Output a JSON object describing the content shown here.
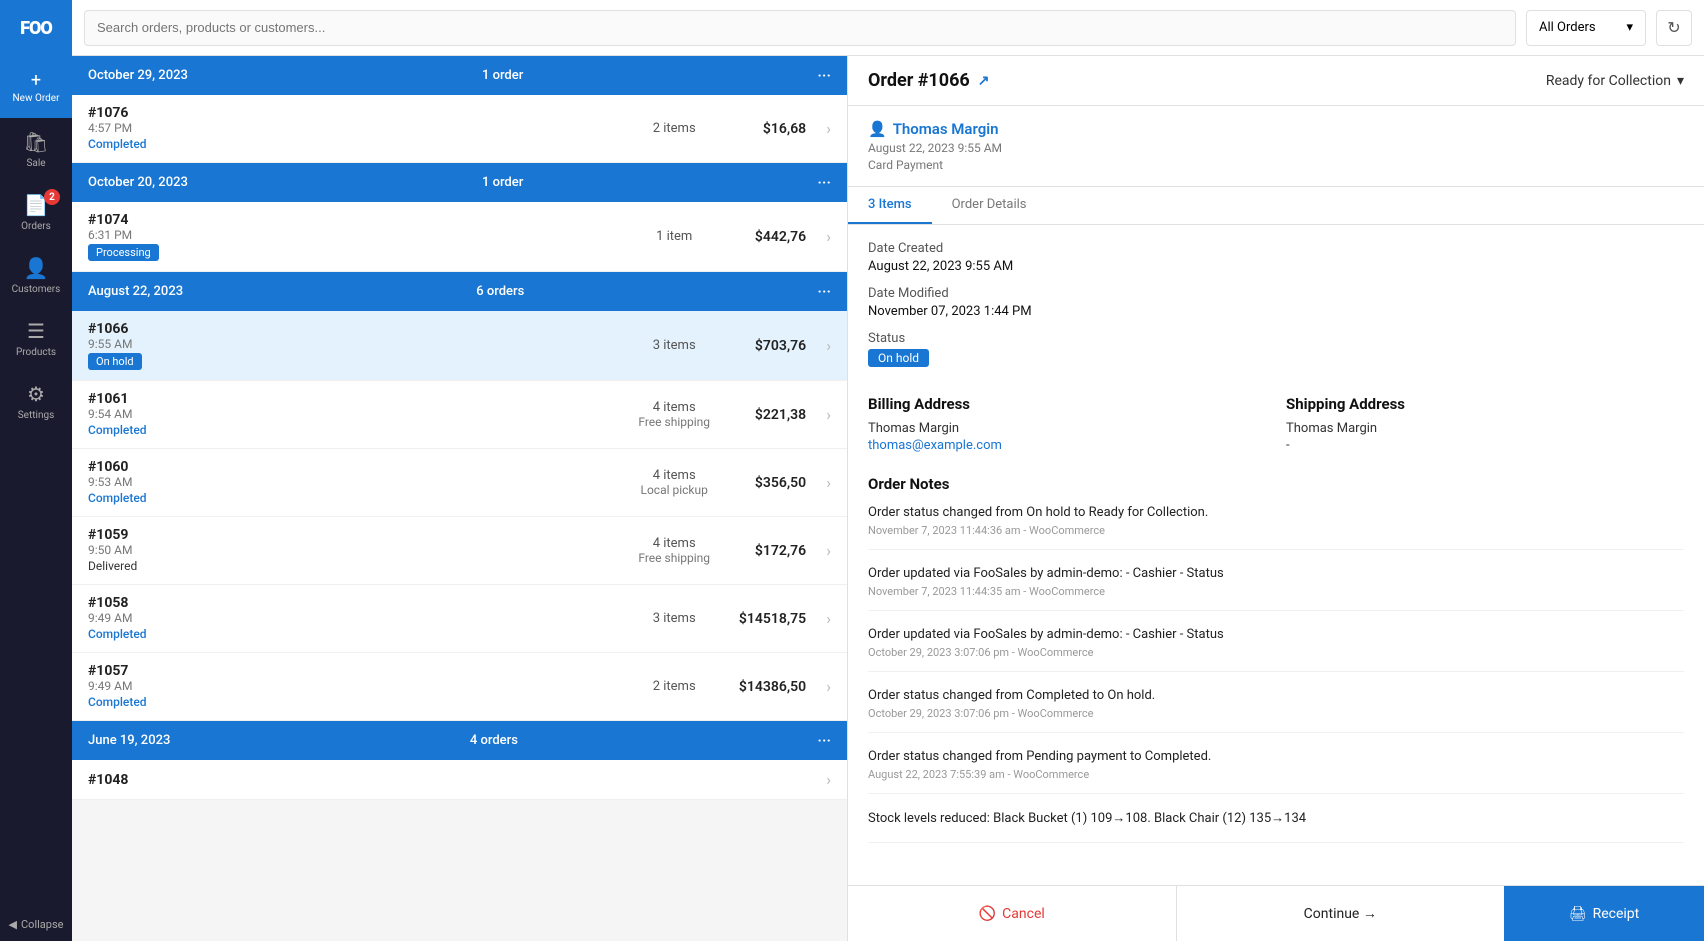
{
  "sidebar": {
    "logo": "FOO",
    "new_order_label": "New Order",
    "items": [
      {
        "id": "sale",
        "icon": "🛍",
        "label": "Sale"
      },
      {
        "id": "orders",
        "icon": "📄",
        "label": "Orders",
        "badge": "2"
      },
      {
        "id": "customers",
        "icon": "👤",
        "label": "Customers"
      },
      {
        "id": "products",
        "icon": "☰",
        "label": "Products"
      },
      {
        "id": "settings",
        "icon": "⚙",
        "label": "Settings"
      }
    ],
    "collapse_label": "Collapse"
  },
  "topbar": {
    "search_placeholder": "Search orders, products or customers...",
    "filter_label": "All Orders",
    "refresh_icon": "↻"
  },
  "orders": {
    "groups": [
      {
        "date": "October 29, 2023",
        "count": "1 order",
        "orders": [
          {
            "id": "#1076",
            "time": "4:57 PM",
            "status": "Completed",
            "status_type": "completed",
            "items": "2 items",
            "shipping": "",
            "amount": "$16,68",
            "selected": false
          }
        ]
      },
      {
        "date": "October 20, 2023",
        "count": "1 order",
        "orders": [
          {
            "id": "#1074",
            "time": "6:31 PM",
            "status": "Processing",
            "status_type": "processing",
            "items": "1 item",
            "shipping": "",
            "amount": "$442,76",
            "selected": false
          }
        ]
      },
      {
        "date": "August 22, 2023",
        "count": "6 orders",
        "orders": [
          {
            "id": "#1066",
            "time": "9:55 AM",
            "status": "On hold",
            "status_type": "onhold",
            "items": "3 items",
            "shipping": "",
            "amount": "$703,76",
            "selected": true
          },
          {
            "id": "#1061",
            "time": "9:54 AM",
            "status": "Completed",
            "status_type": "completed",
            "items": "4 items",
            "shipping": "Free shipping",
            "amount": "$221,38",
            "selected": false
          },
          {
            "id": "#1060",
            "time": "9:53 AM",
            "status": "Completed",
            "status_type": "completed",
            "items": "4 items",
            "shipping": "Local pickup",
            "amount": "$356,50",
            "selected": false
          },
          {
            "id": "#1059",
            "time": "9:50 AM",
            "status": "Delivered",
            "status_type": "delivered",
            "items": "4 items",
            "shipping": "Free shipping",
            "amount": "$172,76",
            "selected": false
          },
          {
            "id": "#1058",
            "time": "9:49 AM",
            "status": "Completed",
            "status_type": "completed",
            "items": "3 items",
            "shipping": "",
            "amount": "$14518,75",
            "selected": false
          },
          {
            "id": "#1057",
            "time": "9:49 AM",
            "status": "Completed",
            "status_type": "completed",
            "items": "2 items",
            "shipping": "",
            "amount": "$14386,50",
            "selected": false
          }
        ]
      },
      {
        "date": "June 19, 2023",
        "count": "4 orders",
        "orders": [
          {
            "id": "#1048",
            "time": "",
            "status": "",
            "status_type": "",
            "items": "",
            "shipping": "",
            "amount": "",
            "selected": false
          }
        ]
      }
    ]
  },
  "detail": {
    "order_number": "Order #1066",
    "external_link_icon": "↗",
    "status_dropdown": "Ready for Collection",
    "customer": {
      "name": "Thomas Margin",
      "date": "August 22, 2023 9:55 AM",
      "payment": "Card Payment",
      "icon": "👤"
    },
    "tabs": [
      {
        "id": "items",
        "label": "3 Items",
        "active": true
      },
      {
        "id": "details",
        "label": "Order Details",
        "active": false
      }
    ],
    "fields": [
      {
        "label": "Date Created",
        "value": "August 22, 2023 9:55 AM"
      },
      {
        "label": "Date Modified",
        "value": "November 07, 2023 1:44 PM"
      },
      {
        "label": "Status",
        "value": "On hold",
        "type": "badge"
      }
    ],
    "billing": {
      "title": "Billing Address",
      "name": "Thomas Margin",
      "email": "thomas@example.com"
    },
    "shipping": {
      "title": "Shipping Address",
      "name": "Thomas Margin",
      "detail": "-"
    },
    "notes_title": "Order Notes",
    "notes": [
      {
        "text": "Order status changed from On hold to Ready for Collection.",
        "meta": "November 7, 2023 11:44:36 am - WooCommerce"
      },
      {
        "text": "Order updated via FooSales by admin-demo: - Cashier - Status",
        "meta": "November 7, 2023 11:44:35 am - WooCommerce"
      },
      {
        "text": "Order updated via FooSales by admin-demo: - Cashier - Status",
        "meta": "October 29, 2023 3:07:06 pm - WooCommerce"
      },
      {
        "text": "Order status changed from Completed to On hold.",
        "meta": "October 29, 2023 3:07:06 pm - WooCommerce"
      },
      {
        "text": "Order status changed from Pending payment to Completed.",
        "meta": "August 22, 2023 7:55:39 am - WooCommerce"
      },
      {
        "text": "Stock levels reduced: Black Bucket (1) 109→108. Black Chair (12) 135→134",
        "meta": ""
      }
    ],
    "actions": {
      "cancel": "Cancel",
      "continue": "Continue →",
      "receipt": "🖨 Receipt"
    }
  }
}
